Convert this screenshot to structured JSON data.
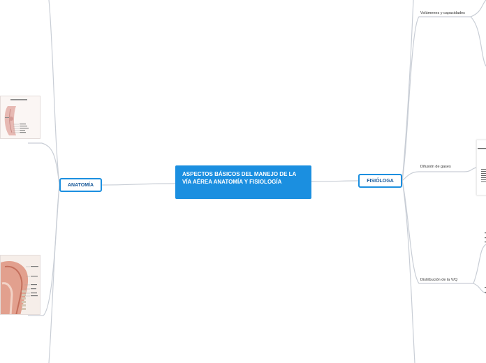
{
  "central": {
    "title": "ASPECTOS BÁSICOS DEL MANEJO DE LA VÍA AÉREA ANATOMÍA Y FISIOLOGÍA"
  },
  "left_branch": {
    "label": "ANATOMÍA"
  },
  "right_branch": {
    "label": "FISIÓLOGA"
  },
  "subtopics": [
    {
      "label": "Volúmenes y capacidades"
    },
    {
      "label": "Difusión de gases"
    },
    {
      "label": "Distribución de la V/Q"
    }
  ],
  "colors": {
    "accent": "#1b8fe0",
    "line": "#c7ccd4"
  }
}
